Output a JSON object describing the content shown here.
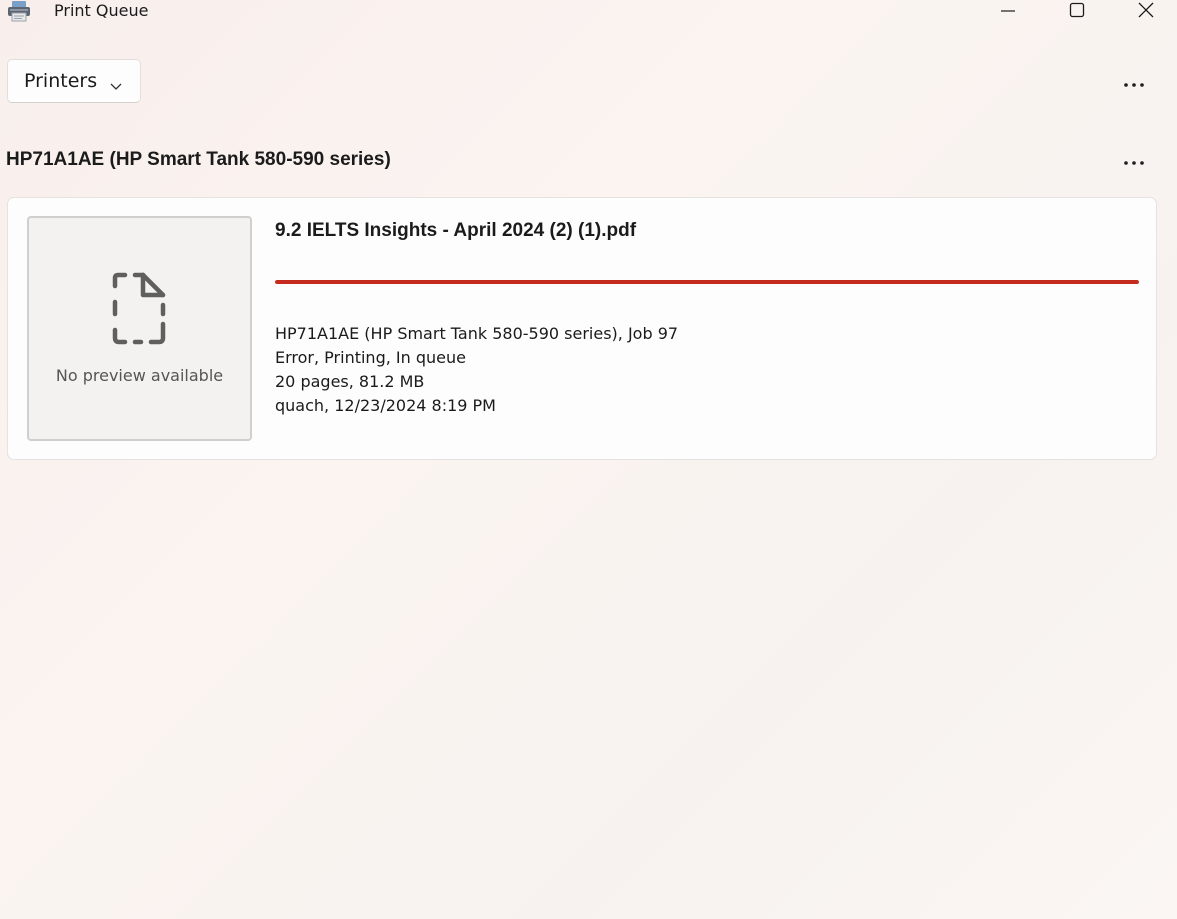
{
  "window": {
    "title": "Print Queue",
    "app_icon": "printer-icon",
    "controls": [
      "minimize-icon",
      "maximize-icon",
      "close-icon"
    ]
  },
  "toolbar": {
    "printers_label": "Printers",
    "printers_icon": "chevron-down-icon",
    "more_icon": "more-horizontal-icon"
  },
  "printer": {
    "name": "HP71A1AE (HP Smart Tank 580-590 series)",
    "more_icon": "more-horizontal-icon"
  },
  "job": {
    "preview_text": "No preview available",
    "preview_icon": "document-placeholder-icon",
    "title": "9.2 IELTS Insights - April 2024 (2) (1).pdf",
    "progress_percent": 100,
    "progress_color": "#c42b1c",
    "details": {
      "printer_job": "HP71A1AE (HP Smart Tank 580-590 series), Job 97",
      "status": "Error, Printing, In queue",
      "size": "20 pages, 81.2 MB",
      "owner_time": "quach, 12/23/2024 8:19 PM"
    }
  }
}
